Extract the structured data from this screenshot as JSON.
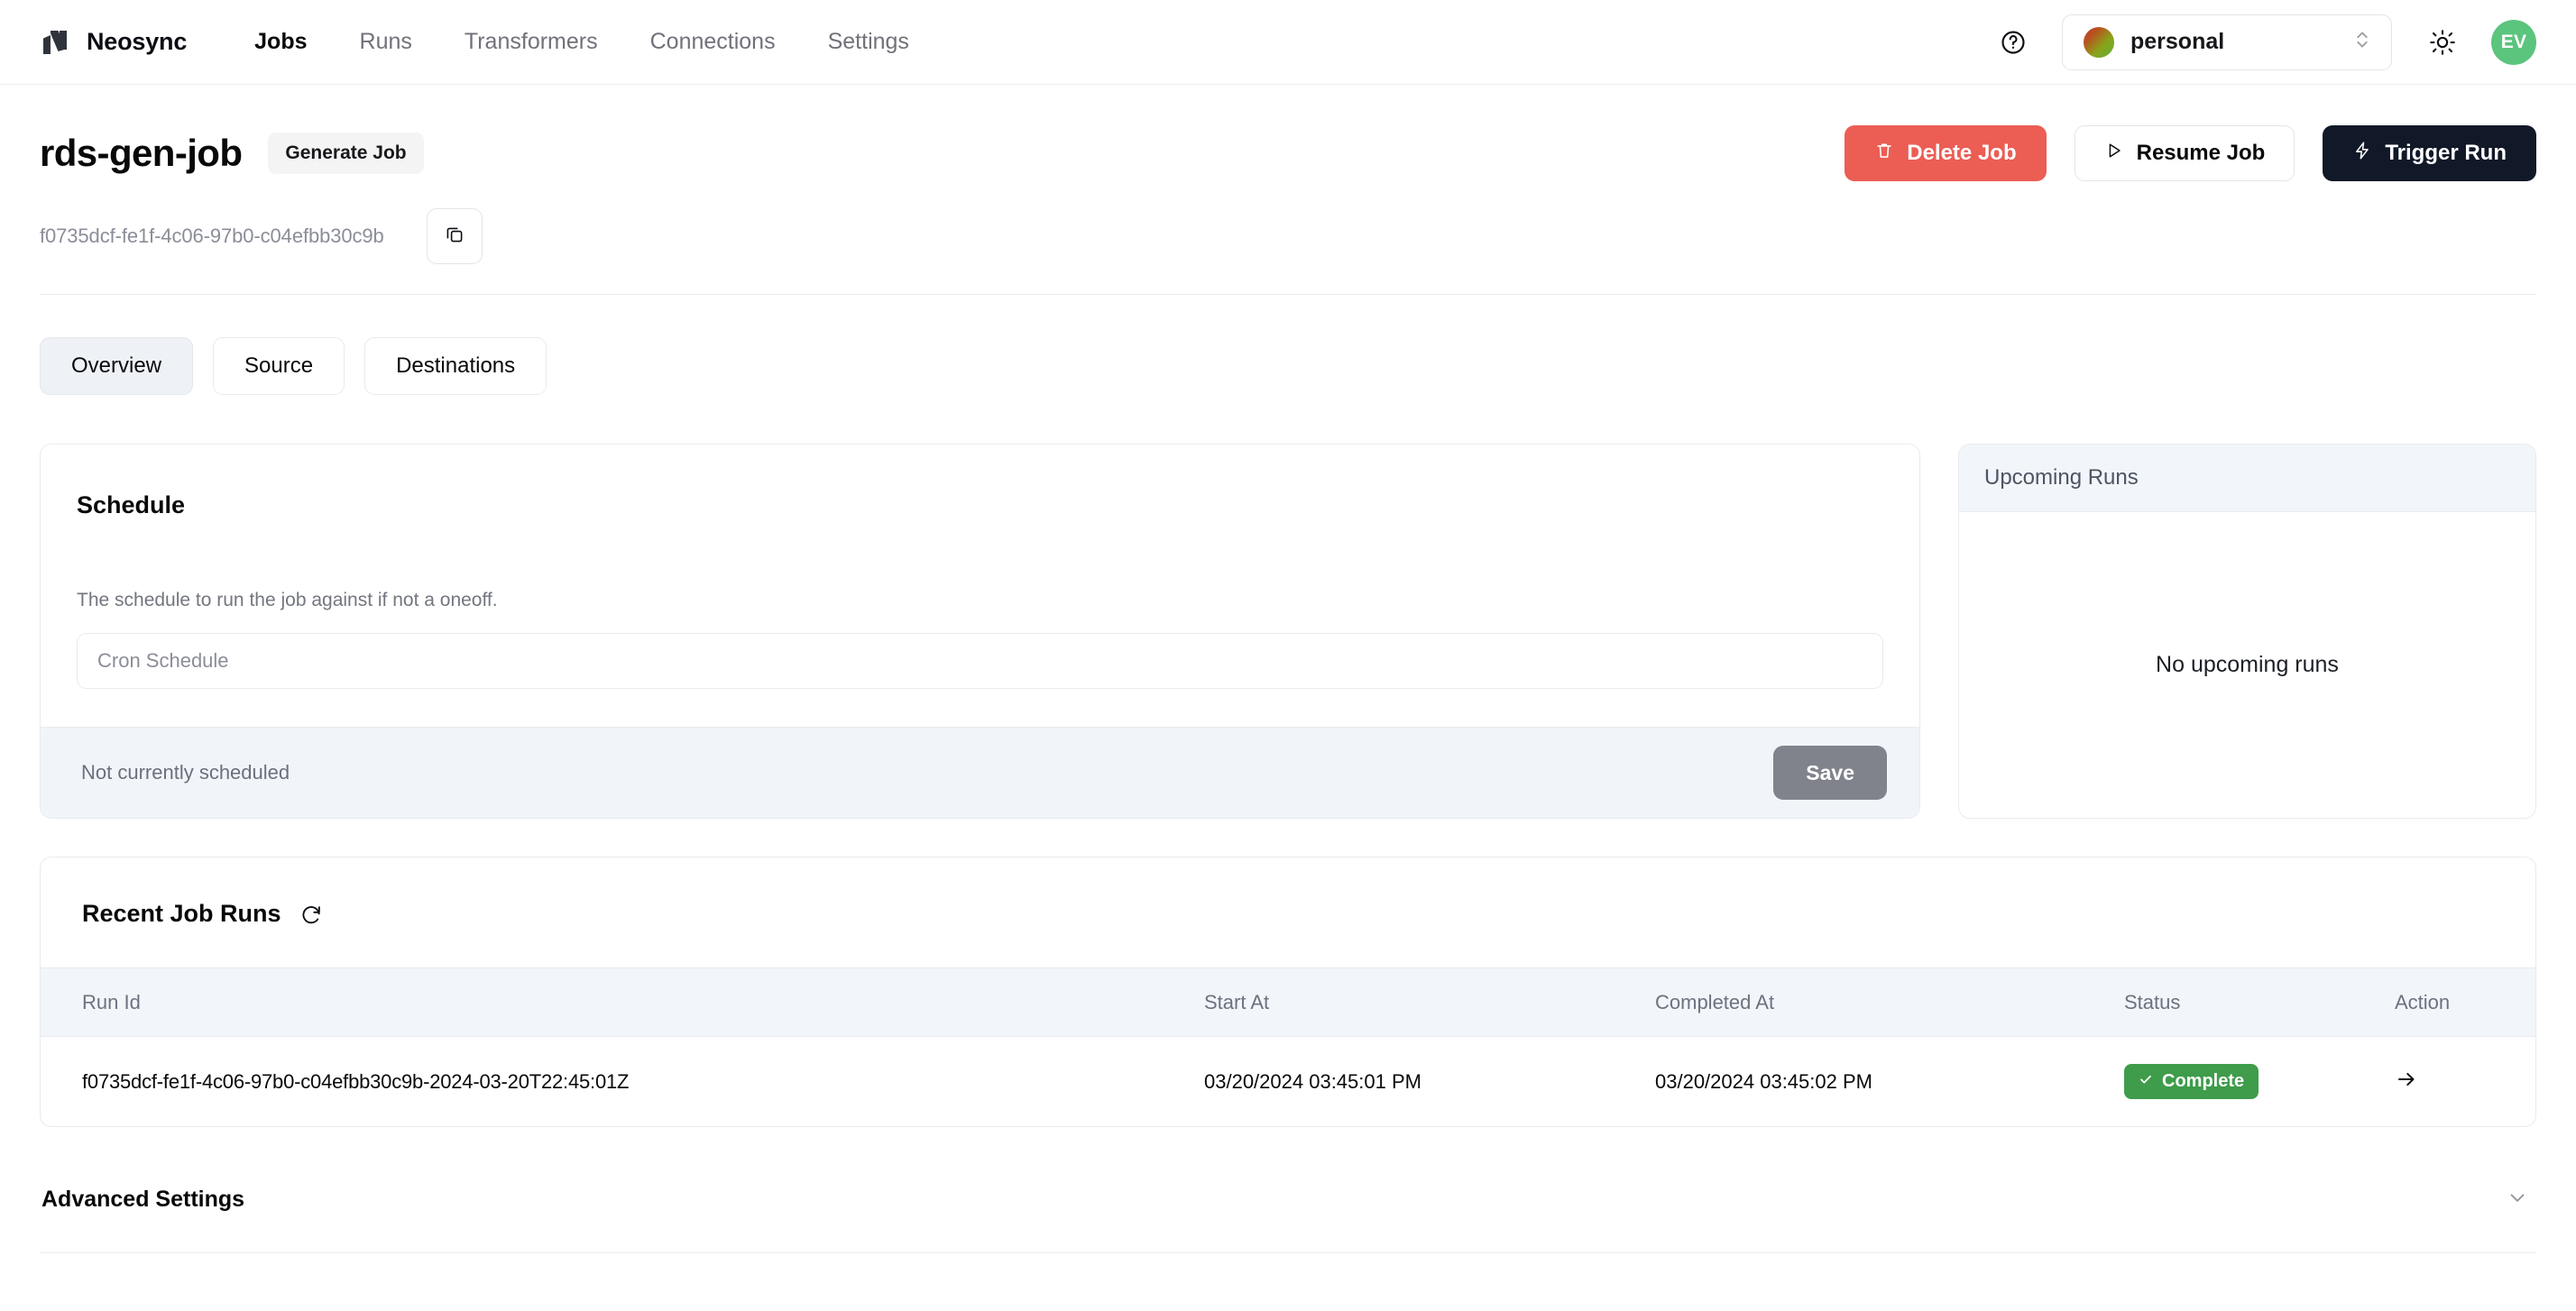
{
  "navbar": {
    "brand": "Neosync",
    "links": [
      {
        "label": "Jobs",
        "active": true
      },
      {
        "label": "Runs",
        "active": false
      },
      {
        "label": "Transformers",
        "active": false
      },
      {
        "label": "Connections",
        "active": false
      },
      {
        "label": "Settings",
        "active": false
      }
    ],
    "help_icon": "question-circle-icon",
    "account": {
      "name": "personal",
      "avatar_gradient_from": "#c0392b",
      "avatar_gradient_to": "#5eb233"
    },
    "theme_icon": "sun-icon",
    "user_initials": "EV",
    "user_avatar_color": "#5bc47d"
  },
  "job": {
    "title": "rds-gen-job",
    "type_badge": "Generate Job",
    "id": "f0735dcf-fe1f-4c06-97b0-c04efbb30c9b",
    "copy_icon": "copy-icon",
    "actions": {
      "delete": {
        "label": "Delete Job",
        "icon": "trash-icon",
        "color": "#ec5d54"
      },
      "resume": {
        "label": "Resume Job",
        "icon": "play-icon"
      },
      "trigger": {
        "label": "Trigger Run",
        "icon": "lightning-icon",
        "color": "#111827"
      }
    }
  },
  "tabs": [
    {
      "label": "Overview",
      "active": true
    },
    {
      "label": "Source",
      "active": false
    },
    {
      "label": "Destinations",
      "active": false
    }
  ],
  "schedule": {
    "title": "Schedule",
    "description": "The schedule to run the job against if not a oneoff.",
    "cron_placeholder": "Cron Schedule",
    "cron_value": "",
    "status": "Not currently scheduled",
    "save_label": "Save"
  },
  "upcoming_runs": {
    "title": "Upcoming Runs",
    "empty_message": "No upcoming runs"
  },
  "recent_runs": {
    "title": "Recent Job Runs",
    "refresh_icon": "refresh-icon",
    "columns": [
      "Run Id",
      "Start At",
      "Completed At",
      "Status",
      "Action"
    ],
    "rows": [
      {
        "run_id": "f0735dcf-fe1f-4c06-97b0-c04efbb30c9b-2024-03-20T22:45:01Z",
        "start_at": "03/20/2024 03:45:01 PM",
        "completed_at": "03/20/2024 03:45:02 PM",
        "status": "Complete",
        "status_color": "#3f9c4b",
        "action_icon": "arrow-right-icon"
      }
    ]
  },
  "advanced_settings": {
    "title": "Advanced Settings",
    "chevron_icon": "chevron-down-icon"
  }
}
